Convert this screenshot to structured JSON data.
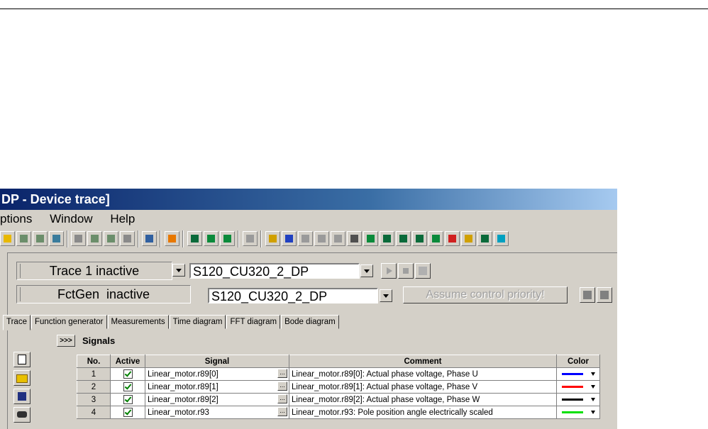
{
  "title": "DP - Device trace]",
  "menu": [
    "ptions",
    "Window",
    "Help"
  ],
  "trace_status": "Trace 1 inactive",
  "trace_device": "S120_CU320_2_DP",
  "fctgen_status": "FctGen  inactive",
  "fctgen_device": "S120_CU320_2_DP",
  "priority_button": "Assume control priority!",
  "tabs": [
    "Trace",
    "Function generator",
    "Measurements",
    "Time diagram",
    "FFT diagram",
    "Bode diagram"
  ],
  "signals_toggle": ">>>",
  "signals_label": "Signals",
  "table": {
    "headers": [
      "No.",
      "Active",
      "Signal",
      "Comment",
      "Color"
    ],
    "ellipsis": "...",
    "rows": [
      {
        "no": "1",
        "signal": "Linear_motor.r89[0]",
        "comment": "Linear_motor.r89[0]: Actual phase voltage, Phase U",
        "color": "#0000ff"
      },
      {
        "no": "2",
        "signal": "Linear_motor.r89[1]",
        "comment": "Linear_motor.r89[1]: Actual phase voltage, Phase V",
        "color": "#ff0000"
      },
      {
        "no": "3",
        "signal": "Linear_motor.r89[2]",
        "comment": "Linear_motor.r89[2]: Actual phase voltage, Phase W",
        "color": "#000000"
      },
      {
        "no": "4",
        "signal": "Linear_motor.r93",
        "comment": "Linear_motor.r93: Pole position angle electrically scaled",
        "color": "#00e000"
      }
    ]
  },
  "icons": [
    "new-file-icon",
    "open-folder-icon",
    "save-disk-icon",
    "binoculars-icon"
  ]
}
